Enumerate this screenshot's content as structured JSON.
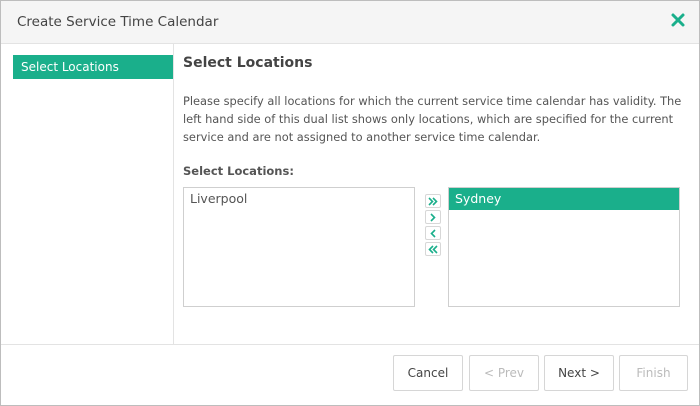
{
  "window": {
    "title": "Create Service Time Calendar",
    "close_icon": "close-icon"
  },
  "colors": {
    "accent": "#1aaf8b",
    "border": "#cfcfcf",
    "header_bg": "#f5f5f5"
  },
  "wizard_nav": {
    "items": [
      {
        "label": "Select Locations",
        "active": true
      }
    ]
  },
  "main": {
    "section_title": "Select Locations",
    "description": "Please specify all locations for which the current service time calendar has validity. The left hand side of this dual list shows only locations, which are specified for the current service and are not assigned to another service time calendar.",
    "field_label": "Select Locations:",
    "available": {
      "items": [
        "Liverpool"
      ]
    },
    "selected": {
      "items": [
        "Sydney"
      ],
      "highlighted": "Sydney"
    },
    "mover_icons": [
      "double-chevron-right-icon",
      "chevron-right-icon",
      "chevron-left-icon",
      "double-chevron-left-icon"
    ]
  },
  "footer": {
    "cancel_label": "Cancel",
    "prev_label": "< Prev",
    "next_label": "Next >",
    "finish_label": "Finish",
    "prev_disabled": true,
    "finish_disabled": true
  }
}
